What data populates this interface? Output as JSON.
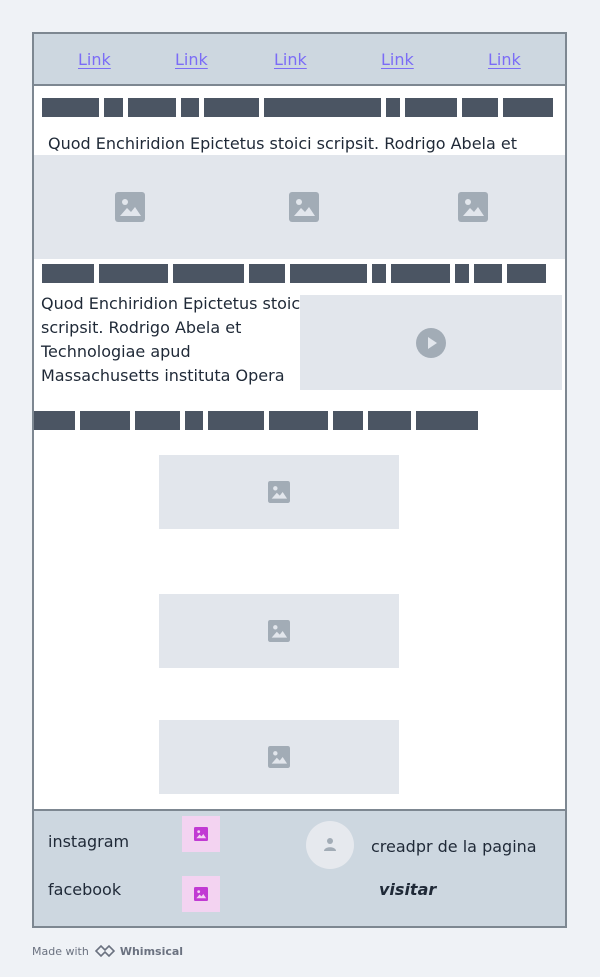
{
  "nav": {
    "links": [
      "Link",
      "Link",
      "Link",
      "Link",
      "Link"
    ]
  },
  "section1": {
    "text": "Quod Enchiridion Epictetus stoici scripsit. Rodrigo Abela et"
  },
  "section2": {
    "text_lines": [
      "Quod Enchiridion Epictetus stoici",
      "scripsit. Rodrigo Abela et",
      "Technologiae apud",
      "Massachusetts instituta Opera"
    ]
  },
  "footer": {
    "instagram": "instagram",
    "facebook": "facebook",
    "creator": "creadpr de la pagina",
    "visit": "visitar"
  },
  "credit": {
    "made_with": "Made with",
    "brand": "Whimsical"
  },
  "colors": {
    "link": "#7b6cf6",
    "nav_bg": "#cdd7e0",
    "bar": "#4b5563",
    "placeholder": "#e2e6ec",
    "placeholder_icon": "#a2acb6",
    "pink_bg": "#f3d3f1",
    "pink_icon": "#c13ad3"
  },
  "icons": {
    "image": "image-icon",
    "play": "play-icon",
    "user": "user-icon",
    "brand": "whimsical-logo-icon"
  }
}
